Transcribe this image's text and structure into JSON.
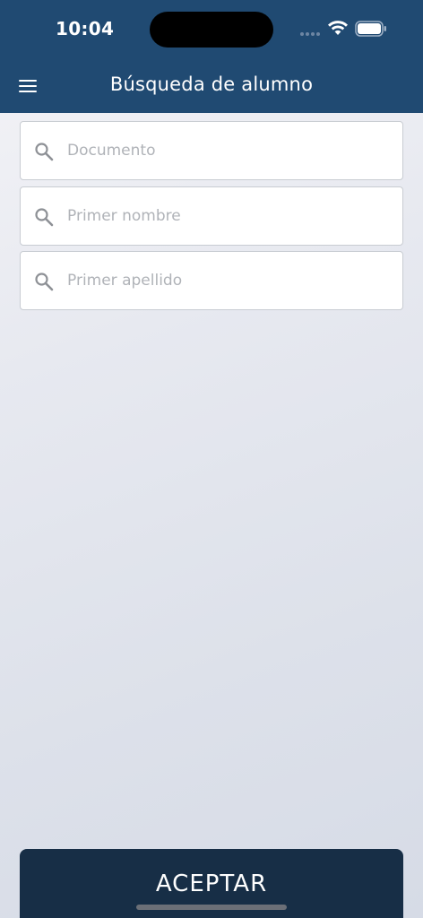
{
  "status_bar": {
    "time": "10:04"
  },
  "nav": {
    "title": "Búsqueda de alumno",
    "menu_icon": "hamburger-menu-icon"
  },
  "search": {
    "fields": [
      {
        "placeholder": "Documento",
        "value": "",
        "icon": "search-icon"
      },
      {
        "placeholder": "Primer nombre",
        "value": "",
        "icon": "search-icon"
      },
      {
        "placeholder": "Primer apellido",
        "value": "",
        "icon": "search-icon"
      }
    ]
  },
  "footer": {
    "accept_label": "ACEPTAR"
  },
  "colors": {
    "header": "#204a72",
    "button": "#172e46",
    "placeholder": "#b0b3b8",
    "icon": "#8e9196"
  }
}
